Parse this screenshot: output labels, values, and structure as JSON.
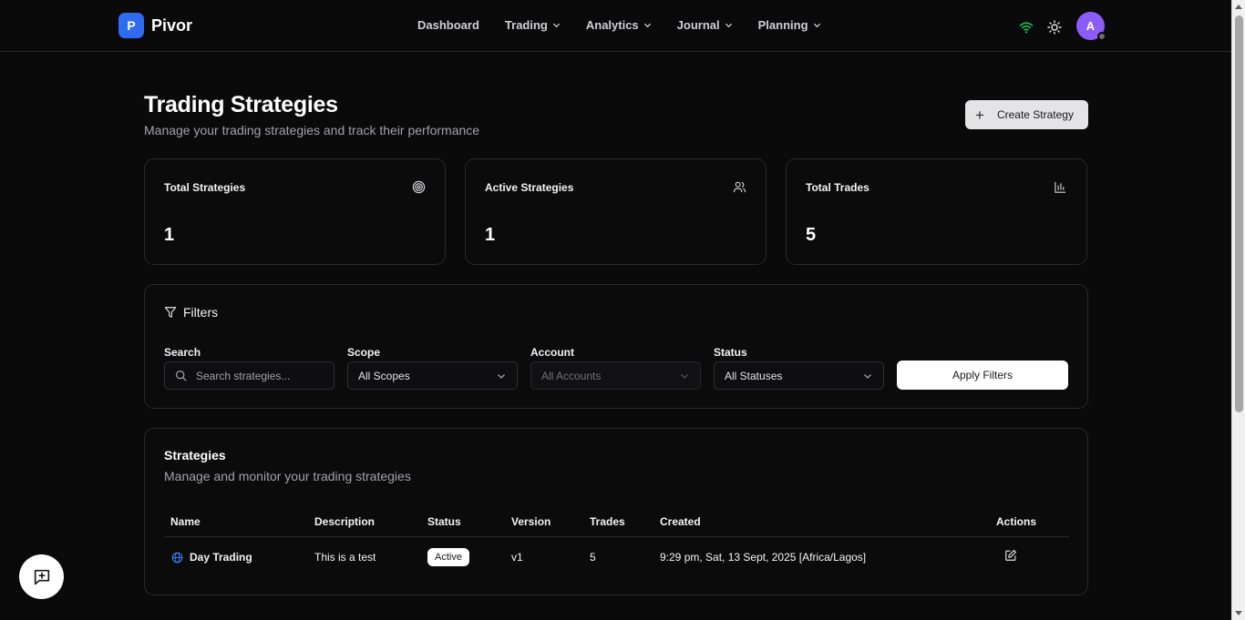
{
  "app": {
    "logo_letter": "P",
    "name": "Pivor"
  },
  "nav": {
    "items": [
      {
        "label": "Dashboard",
        "has_menu": false
      },
      {
        "label": "Trading",
        "has_menu": true
      },
      {
        "label": "Analytics",
        "has_menu": true
      },
      {
        "label": "Journal",
        "has_menu": true
      },
      {
        "label": "Planning",
        "has_menu": true
      }
    ],
    "avatar_initial": "A",
    "status_color": "#22c55e"
  },
  "header": {
    "title": "Trading Strategies",
    "subtitle": "Manage your trading strategies and track their performance",
    "create_label": "Create Strategy"
  },
  "stats": [
    {
      "title": "Total Strategies",
      "value": "1",
      "icon": "target-icon"
    },
    {
      "title": "Active Strategies",
      "value": "1",
      "icon": "users-icon"
    },
    {
      "title": "Total Trades",
      "value": "5",
      "icon": "bar-chart-icon"
    }
  ],
  "filters": {
    "title": "Filters",
    "search": {
      "label": "Search",
      "placeholder": "Search strategies..."
    },
    "scope": {
      "label": "Scope",
      "value": "All Scopes"
    },
    "account": {
      "label": "Account",
      "value": "All Accounts"
    },
    "status": {
      "label": "Status",
      "value": "All Statuses"
    },
    "apply_label": "Apply Filters"
  },
  "strategies": {
    "title": "Strategies",
    "subtitle": "Manage and monitor your trading strategies",
    "columns": [
      "Name",
      "Description",
      "Status",
      "Version",
      "Trades",
      "Created",
      "Actions"
    ],
    "rows": [
      {
        "name": "Day Trading",
        "description": "This is a test",
        "status": "Active",
        "version": "v1",
        "trades": "5",
        "created": "9:29 pm, Sat, 13 Sept, 2025 [Africa/Lagos]"
      }
    ]
  },
  "colors": {
    "accent": "#2f6bf2",
    "avatar": "#8b5cf6",
    "background": "#0a0a0b"
  }
}
